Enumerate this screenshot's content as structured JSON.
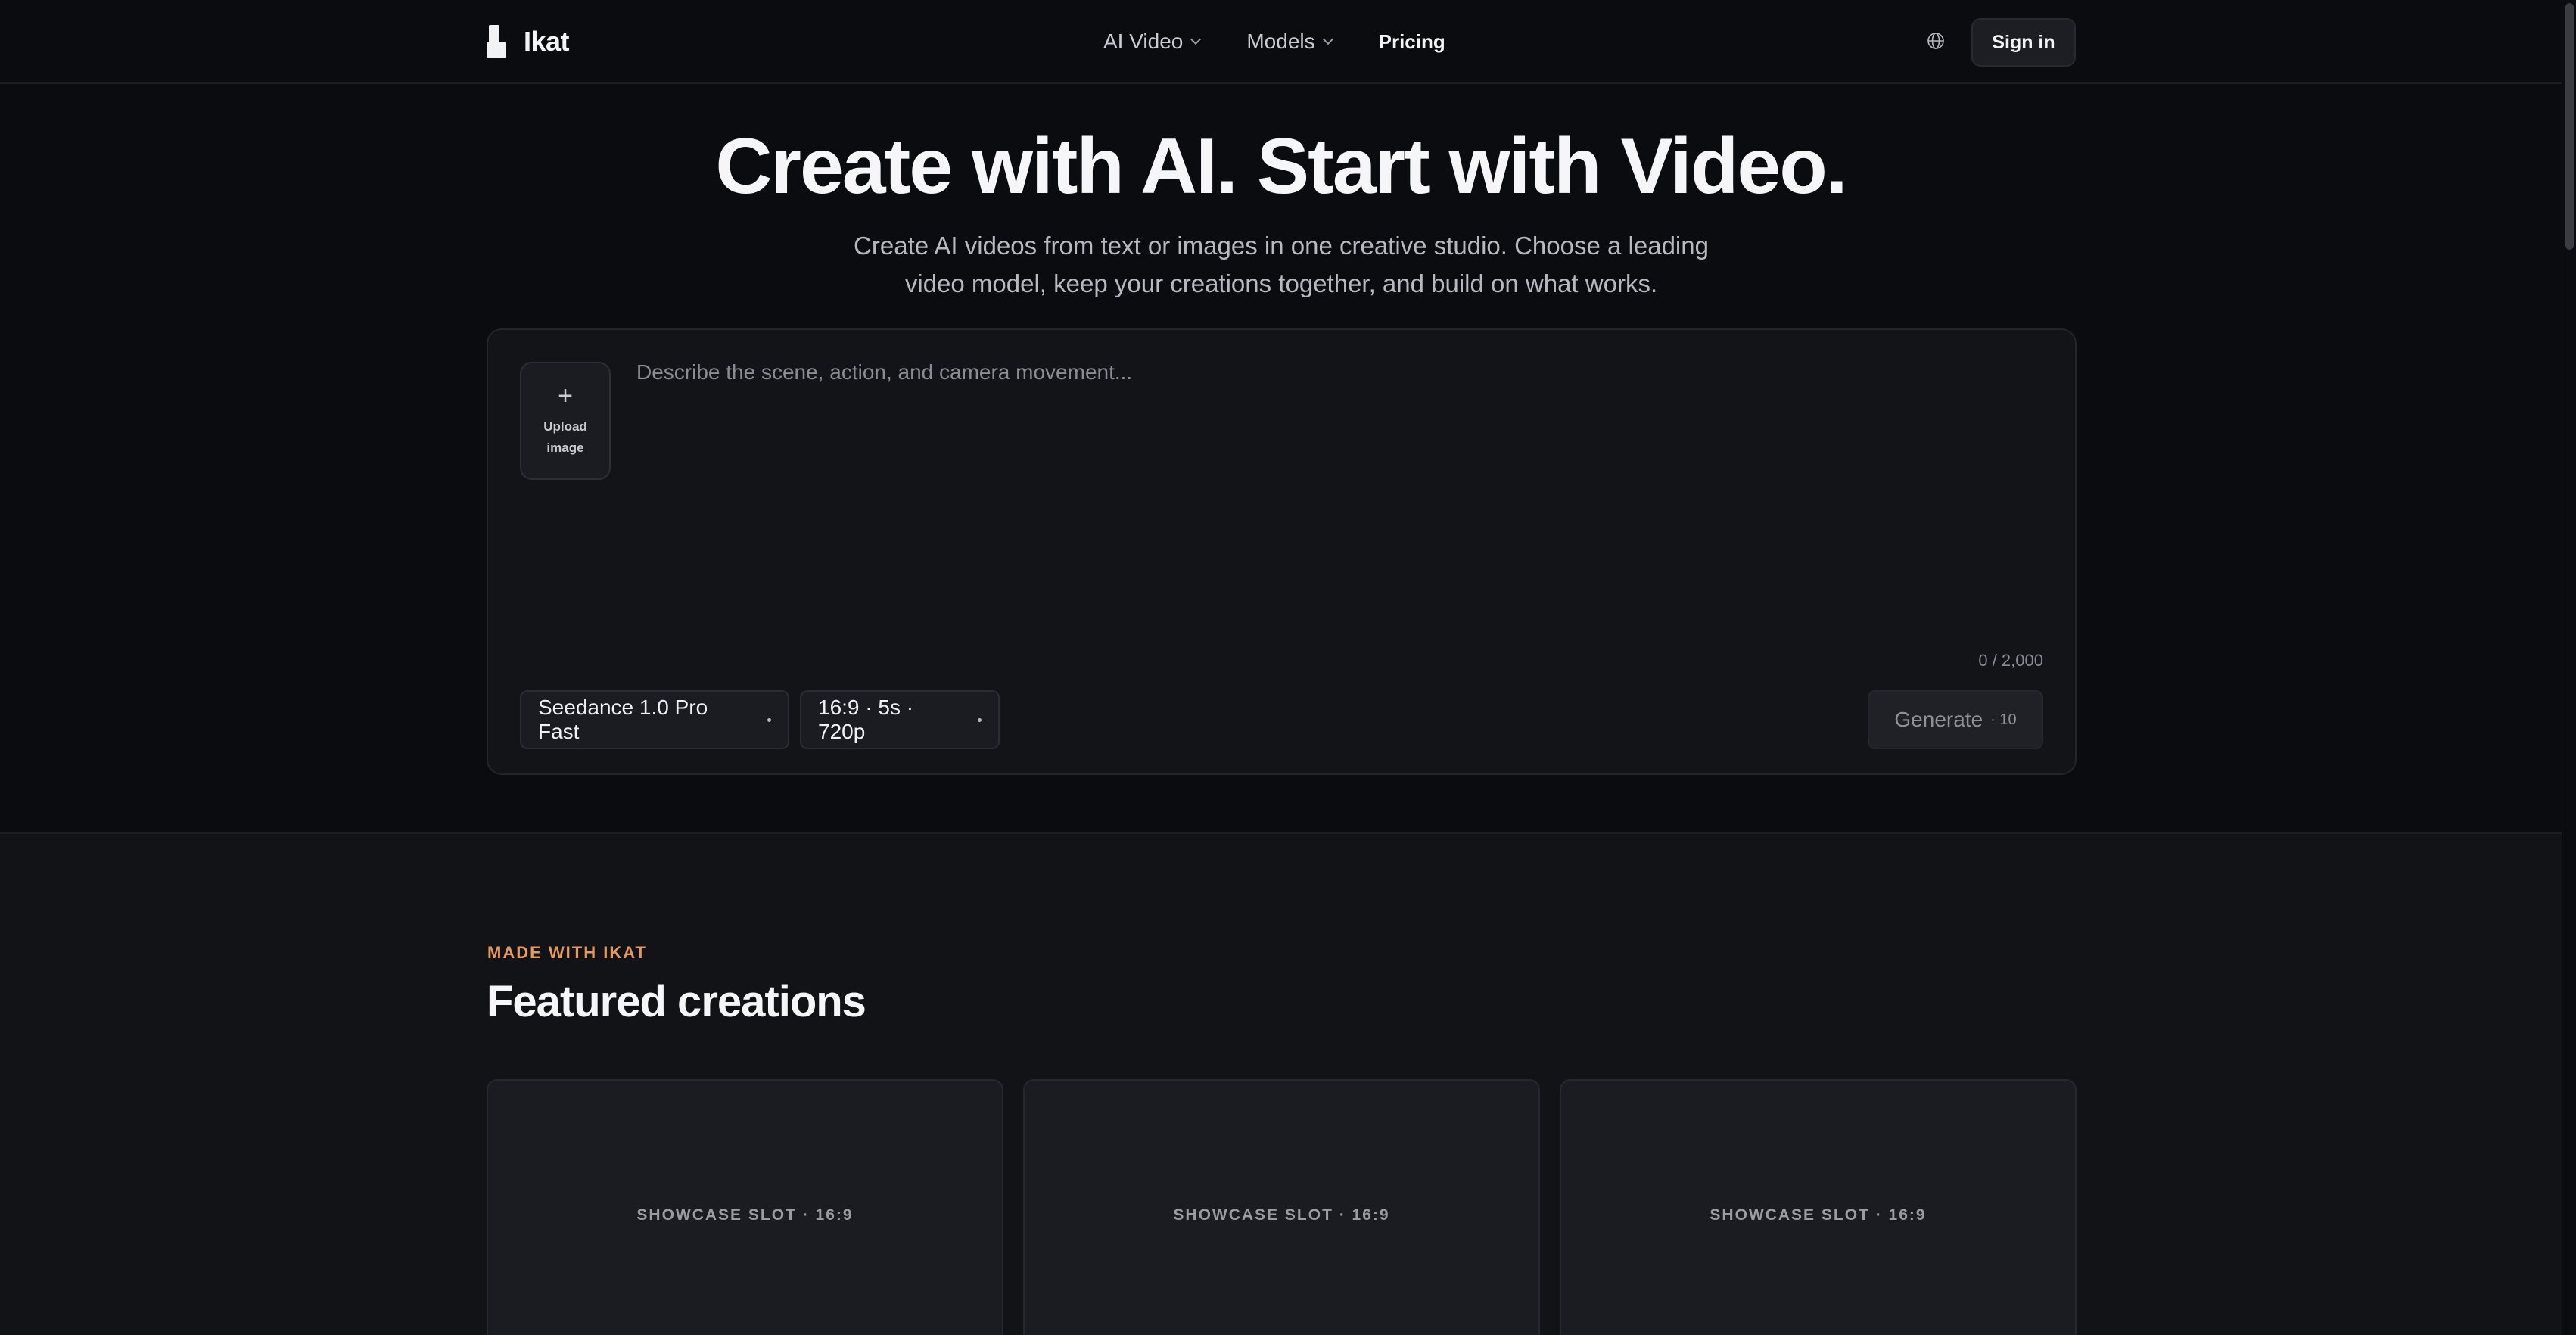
{
  "header": {
    "brand": "Ikat",
    "nav": [
      {
        "label": "AI Video",
        "has_dropdown": true
      },
      {
        "label": "Models",
        "has_dropdown": true
      },
      {
        "label": "Pricing",
        "has_dropdown": false
      }
    ],
    "language_icon": "globe-icon",
    "signin_label": "Sign in"
  },
  "hero": {
    "title": "Create with AI. Start with Video.",
    "subtitle": "Create AI videos from text or images in one creative studio. Choose a leading video model, keep your creations together, and build on what works."
  },
  "prompt": {
    "upload_icon": "plus-icon",
    "upload_label_1": "Upload",
    "upload_label_2": "image",
    "value": "",
    "placeholder": "Describe the scene, action, and camera movement...",
    "counter": "0 / 2,000",
    "model": "Seedance 1.0 Pro Fast",
    "options": "16:9 · 5s · 720p",
    "generate_label": "Generate",
    "generate_cost": "· 10"
  },
  "featured": {
    "eyebrow": "MADE WITH IKAT",
    "title": "Featured creations",
    "slots": [
      {
        "label": "SHOWCASE SLOT · 16:9"
      },
      {
        "label": "SHOWCASE SLOT · 16:9"
      },
      {
        "label": "SHOWCASE SLOT · 16:9"
      }
    ]
  },
  "colors": {
    "background": "#0b0c0f",
    "card": "#131418",
    "accent": "#e79a5e",
    "text": "#f6f6f8"
  }
}
